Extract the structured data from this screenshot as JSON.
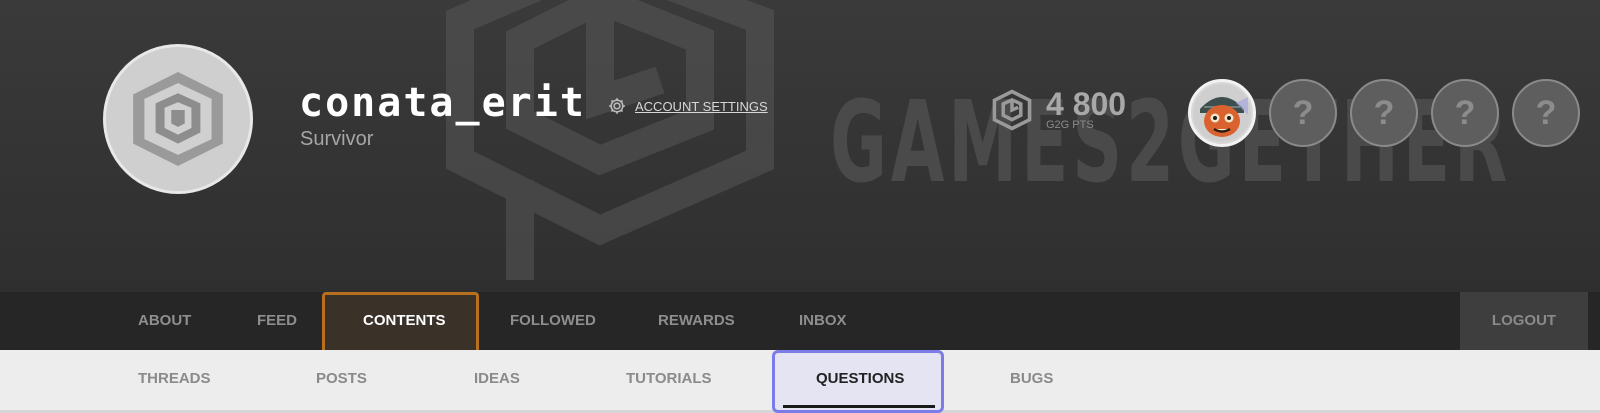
{
  "profile": {
    "username": "conata_erit",
    "rank": "Survivor",
    "account_settings_label": "ACCOUNT SETTINGS"
  },
  "points": {
    "value": "4 800",
    "label": "G2G PTS"
  },
  "watermark": {
    "text": "GAMES2GETHER"
  },
  "badges": [
    {
      "name": "avatar-character-icon",
      "label": "",
      "unlocked": true
    },
    {
      "name": "locked-badge",
      "label": "?",
      "unlocked": false
    },
    {
      "name": "locked-badge",
      "label": "?",
      "unlocked": false
    },
    {
      "name": "locked-badge",
      "label": "?",
      "unlocked": false
    },
    {
      "name": "locked-badge",
      "label": "?",
      "unlocked": false
    }
  ],
  "main_nav": {
    "items": [
      {
        "label": "ABOUT"
      },
      {
        "label": "FEED"
      },
      {
        "label": "CONTENTS",
        "active": true
      },
      {
        "label": "FOLLOWED"
      },
      {
        "label": "REWARDS"
      },
      {
        "label": "INBOX"
      }
    ],
    "logout_label": "LOGOUT"
  },
  "sub_nav": {
    "items": [
      {
        "label": "THREADS"
      },
      {
        "label": "POSTS"
      },
      {
        "label": "IDEAS"
      },
      {
        "label": "TUTORIALS"
      },
      {
        "label": "QUESTIONS",
        "active": true
      },
      {
        "label": "BUGS"
      }
    ]
  },
  "colors": {
    "hero_bg": "#353535",
    "nav_bg": "#262626",
    "contents_highlight": "#b8701e",
    "questions_highlight": "#7b7ce8"
  }
}
